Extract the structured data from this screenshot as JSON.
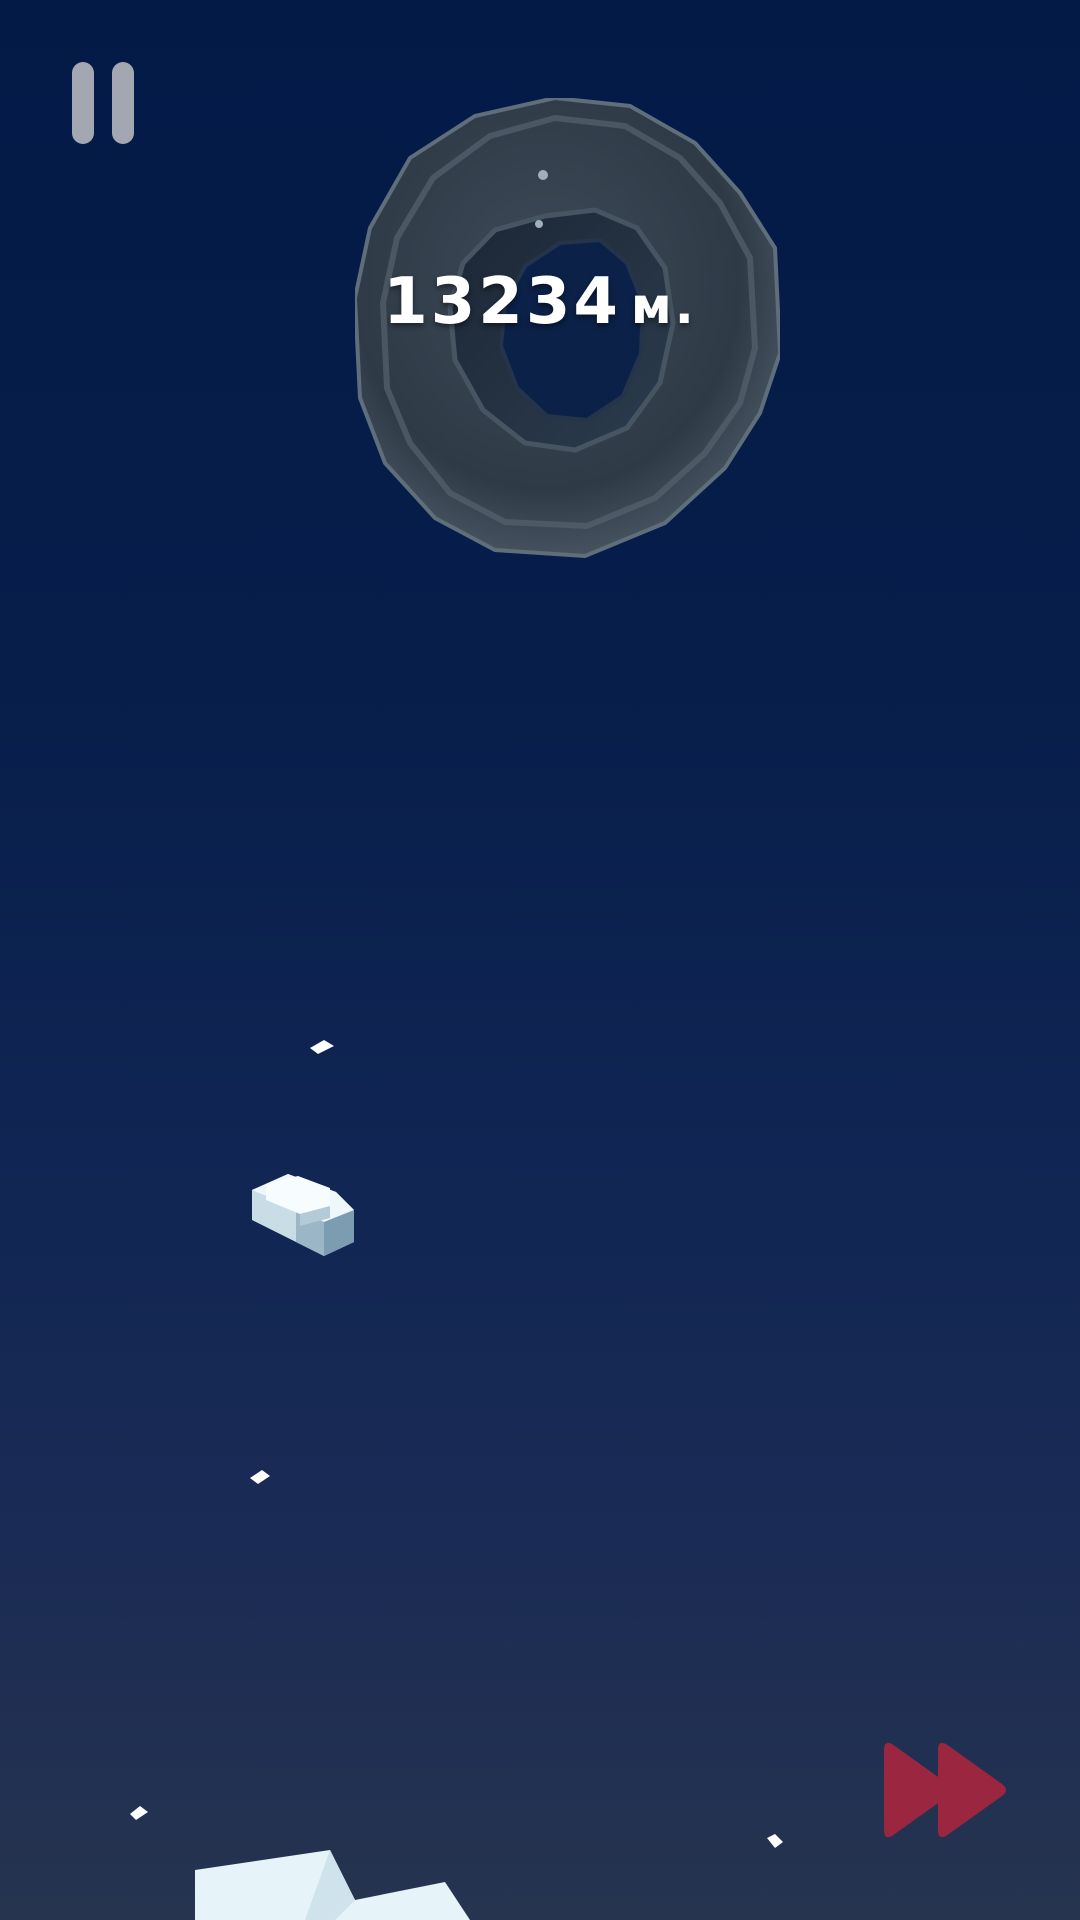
{
  "hud": {
    "distance_value": "13234",
    "distance_unit": "м."
  },
  "icons": {
    "pause": "pause-icon",
    "fast_forward": "fast-forward-icon"
  },
  "colors": {
    "background_top": "#031a47",
    "background_bottom": "#26344f",
    "pause_button": "#a2a7b2",
    "fast_forward": "#9b2640",
    "distance_text": "#ffffff",
    "ice": "#e6f3f8"
  }
}
